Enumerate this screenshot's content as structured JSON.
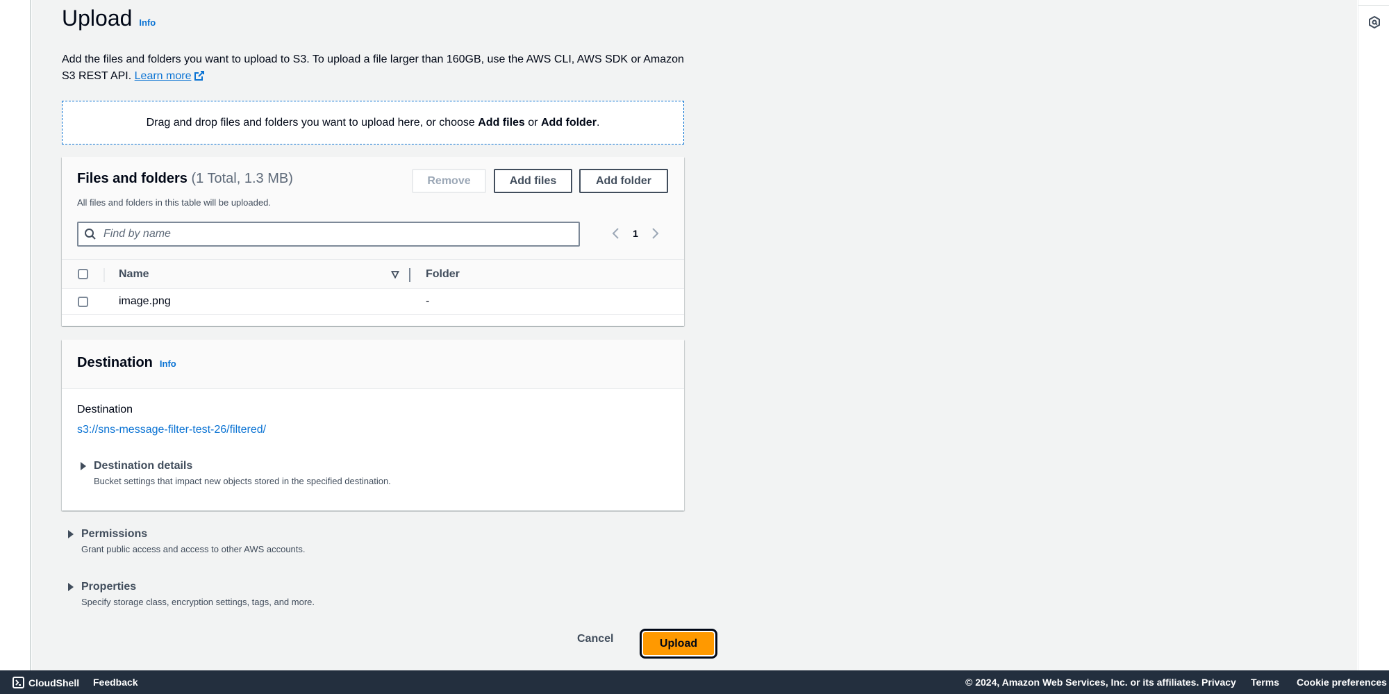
{
  "page": {
    "title": "Upload",
    "info_label": "Info",
    "intro_text": "Add the files and folders you want to upload to S3. To upload a file larger than 160GB, use the AWS CLI, AWS SDK or Amazon S3 REST API. ",
    "learn_more": "Learn more"
  },
  "dropzone": {
    "prefix": "Drag and drop files and folders you want to upload here, or choose ",
    "add_files": "Add files",
    "or": " or ",
    "add_folder": "Add folder",
    "suffix": "."
  },
  "files_panel": {
    "title": "Files and folders",
    "count": "(1 Total, 1.3 MB)",
    "description": "All files and folders in this table will be uploaded.",
    "buttons": {
      "remove": "Remove",
      "add_files": "Add files",
      "add_folder": "Add folder"
    },
    "search_placeholder": "Find by name",
    "search_value": "",
    "pagination": {
      "current_page": "1"
    },
    "columns": [
      "Name",
      "Folder"
    ],
    "rows": [
      {
        "name": "image.png",
        "folder": "-",
        "selected": false
      }
    ]
  },
  "destination_panel": {
    "title": "Destination",
    "info_label": "Info",
    "field_label": "Destination",
    "value": "s3://sns-message-filter-test-26/filtered/",
    "details": {
      "title": "Destination details",
      "description": "Bucket settings that impact new objects stored in the specified destination."
    }
  },
  "sections": {
    "permissions": {
      "title": "Permissions",
      "description": "Grant public access and access to other AWS accounts."
    },
    "properties": {
      "title": "Properties",
      "description": "Specify storage class, encryption settings, tags, and more."
    }
  },
  "actions": {
    "cancel": "Cancel",
    "upload": "Upload"
  },
  "footer": {
    "cloudshell": "CloudShell",
    "feedback": "Feedback",
    "copyright": "© 2024, Amazon Web Services, Inc. or its affiliates.",
    "privacy": "Privacy",
    "terms": "Terms",
    "cookie_preferences": "Cookie preferences"
  },
  "colors": {
    "link": "#0972d3",
    "primary_button": "#ff9900",
    "footer_bg": "#232f3e",
    "page_bg": "#f2f3f3"
  },
  "icons": {
    "right_rail": "hexagon-settings-icon",
    "search": "search-icon",
    "external_link": "external-link-icon",
    "cloudshell": "terminal-icon"
  }
}
